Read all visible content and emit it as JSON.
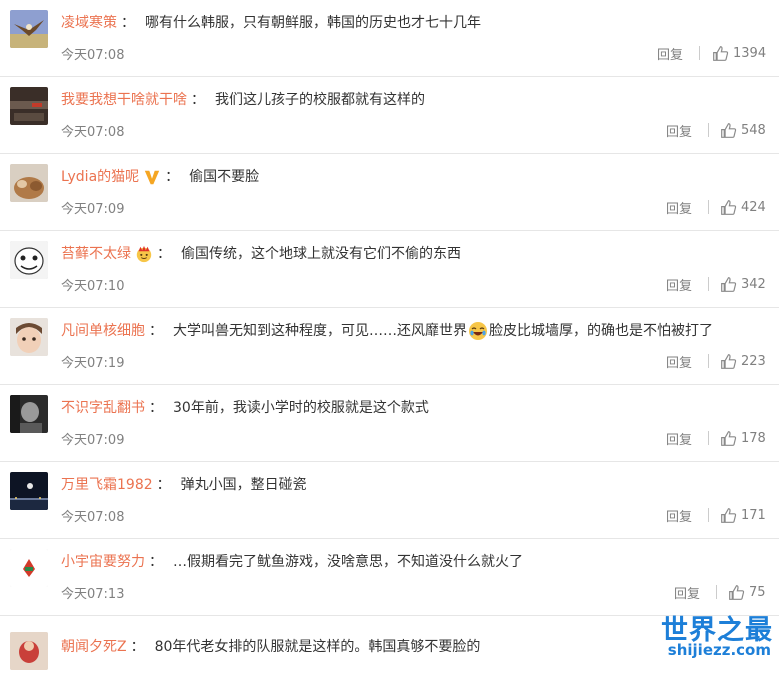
{
  "labels": {
    "reply": "回复"
  },
  "colors": {
    "username": "#eb7350",
    "watermark": "#1d7fd8"
  },
  "comments": [
    {
      "user": "凌域寒策",
      "text": "哪有什么韩服，只有朝鲜服，韩国的历史也才七十几年",
      "time": "今天07:08",
      "likes": "1394",
      "avatar": "eagle-avatar"
    },
    {
      "user": "我要我想干啥就干啥",
      "text": "我们这儿孩子的校服都就有这样的",
      "time": "今天07:08",
      "likes": "548",
      "avatar": "dark-photo-avatar"
    },
    {
      "user": "Lydia的猫呢",
      "text": "偷国不要脸",
      "time": "今天07:09",
      "likes": "424",
      "avatar": "cat-avatar",
      "badge": "v-badge-icon"
    },
    {
      "user": "苔藓不太绿",
      "text": "偷国传统，这个地球上就没有它们不偷的东西",
      "time": "今天07:10",
      "likes": "342",
      "avatar": "meme-face-avatar",
      "badge": "crown-emoji-icon"
    },
    {
      "user": "凡间单核细胞",
      "text_before": "大学叫兽无知到这种程度，可见……还风靡世界",
      "text_after": "脸皮比城墙厚，的确也是不怕被打了",
      "time": "今天07:19",
      "likes": "223",
      "avatar": "child-avatar",
      "emoji": "laughing-emoji-icon"
    },
    {
      "user": "不识字乱翻书",
      "text": "30年前，我读小学时的校服就是这个款式",
      "time": "今天07:09",
      "likes": "178",
      "avatar": "bw-photo-avatar"
    },
    {
      "user": "万里飞霜1982",
      "text": "弹丸小国，整日碰瓷",
      "time": "今天07:08",
      "likes": "171",
      "avatar": "night-city-avatar"
    },
    {
      "user": "小宇宙要努力",
      "text": "…假期看完了鱿鱼游戏，没啥意思，不知道没什么就火了",
      "time": "今天07:13",
      "likes": "75",
      "avatar": "logo-avatar"
    },
    {
      "user": "朝闻夕死Z",
      "text": "80年代老女排的队服就是这样的。韩国真够不要脸的",
      "avatar": "red-avatar"
    }
  ],
  "watermark": {
    "title": "世界之最",
    "url": "shijiezz.com"
  }
}
